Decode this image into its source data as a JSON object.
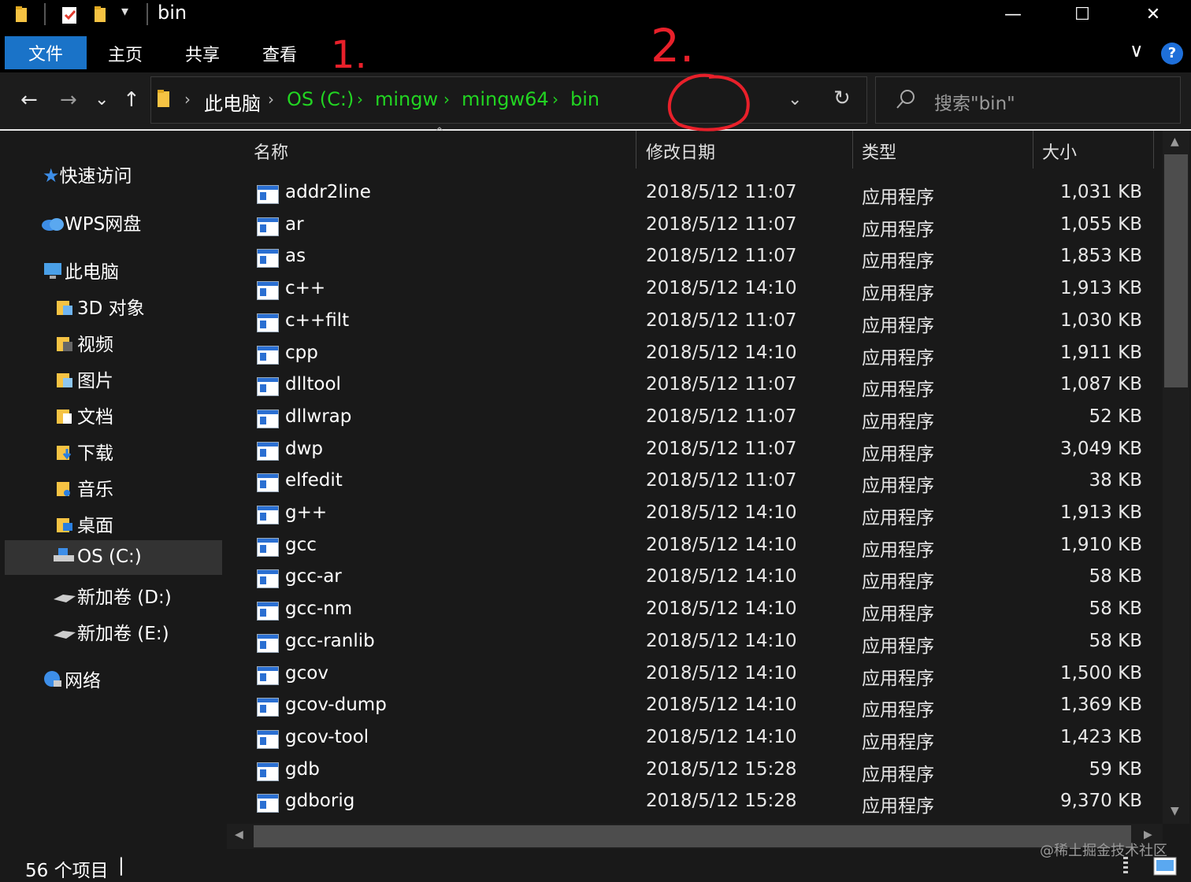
{
  "window": {
    "title": "bin",
    "quick_access_dropdown": "▾",
    "minimize": "—",
    "maximize": "☐",
    "close": "✕"
  },
  "ribbon": {
    "tabs": [
      "文件",
      "主页",
      "共享",
      "查看"
    ],
    "collapse": "∨",
    "help": "?"
  },
  "annotations": {
    "mark1": "1.",
    "mark2": "2.",
    "circle_color": "#e8202a"
  },
  "nav": {
    "back": "←",
    "forward": "→",
    "recent": "⌄",
    "up": "↑",
    "breadcrumbs": [
      "此电脑",
      "OS (C:)",
      "mingw",
      "mingw64",
      "bin"
    ],
    "crumb_sep": "›",
    "history_dropdown": "⌄",
    "refresh": "↻",
    "search_placeholder": "搜索\"bin\""
  },
  "sidebar": {
    "items": [
      {
        "label": "快速访问",
        "icon": "star-icon"
      },
      {
        "label": "WPS网盘",
        "icon": "cloud-icon"
      },
      {
        "label": "此电脑",
        "icon": "computer-icon"
      },
      {
        "label": "3D 对象",
        "icon": "folder-3d-icon"
      },
      {
        "label": "视频",
        "icon": "folder-video-icon"
      },
      {
        "label": "图片",
        "icon": "folder-pictures-icon"
      },
      {
        "label": "文档",
        "icon": "folder-documents-icon"
      },
      {
        "label": "下载",
        "icon": "folder-downloads-icon"
      },
      {
        "label": "音乐",
        "icon": "folder-music-icon"
      },
      {
        "label": "桌面",
        "icon": "folder-desktop-icon"
      },
      {
        "label": "OS (C:)",
        "icon": "drive-c-icon"
      },
      {
        "label": "新加卷 (D:)",
        "icon": "drive-icon"
      },
      {
        "label": "新加卷 (E:)",
        "icon": "drive-icon"
      },
      {
        "label": "网络",
        "icon": "network-icon"
      }
    ]
  },
  "columns": {
    "name": "名称",
    "date": "修改日期",
    "type": "类型",
    "size": "大小"
  },
  "files": [
    {
      "name": "addr2line",
      "date": "2018/5/12 11:07",
      "type": "应用程序",
      "size": "1,031 KB"
    },
    {
      "name": "ar",
      "date": "2018/5/12 11:07",
      "type": "应用程序",
      "size": "1,055 KB"
    },
    {
      "name": "as",
      "date": "2018/5/12 11:07",
      "type": "应用程序",
      "size": "1,853 KB"
    },
    {
      "name": "c++",
      "date": "2018/5/12 14:10",
      "type": "应用程序",
      "size": "1,913 KB"
    },
    {
      "name": "c++filt",
      "date": "2018/5/12 11:07",
      "type": "应用程序",
      "size": "1,030 KB"
    },
    {
      "name": "cpp",
      "date": "2018/5/12 14:10",
      "type": "应用程序",
      "size": "1,911 KB"
    },
    {
      "name": "dlltool",
      "date": "2018/5/12 11:07",
      "type": "应用程序",
      "size": "1,087 KB"
    },
    {
      "name": "dllwrap",
      "date": "2018/5/12 11:07",
      "type": "应用程序",
      "size": "52 KB"
    },
    {
      "name": "dwp",
      "date": "2018/5/12 11:07",
      "type": "应用程序",
      "size": "3,049 KB"
    },
    {
      "name": "elfedit",
      "date": "2018/5/12 11:07",
      "type": "应用程序",
      "size": "38 KB"
    },
    {
      "name": "g++",
      "date": "2018/5/12 14:10",
      "type": "应用程序",
      "size": "1,913 KB"
    },
    {
      "name": "gcc",
      "date": "2018/5/12 14:10",
      "type": "应用程序",
      "size": "1,910 KB"
    },
    {
      "name": "gcc-ar",
      "date": "2018/5/12 14:10",
      "type": "应用程序",
      "size": "58 KB"
    },
    {
      "name": "gcc-nm",
      "date": "2018/5/12 14:10",
      "type": "应用程序",
      "size": "58 KB"
    },
    {
      "name": "gcc-ranlib",
      "date": "2018/5/12 14:10",
      "type": "应用程序",
      "size": "58 KB"
    },
    {
      "name": "gcov",
      "date": "2018/5/12 14:10",
      "type": "应用程序",
      "size": "1,500 KB"
    },
    {
      "name": "gcov-dump",
      "date": "2018/5/12 14:10",
      "type": "应用程序",
      "size": "1,369 KB"
    },
    {
      "name": "gcov-tool",
      "date": "2018/5/12 14:10",
      "type": "应用程序",
      "size": "1,423 KB"
    },
    {
      "name": "gdb",
      "date": "2018/5/12 15:28",
      "type": "应用程序",
      "size": "59 KB"
    },
    {
      "name": "gdborig",
      "date": "2018/5/12 15:28",
      "type": "应用程序",
      "size": "9,370 KB"
    }
  ],
  "status": {
    "count": "56 个项目",
    "separator": "|"
  },
  "watermark": "@稀土掘金技术社区",
  "colors": {
    "accent": "#1a73c8",
    "breadcrumb_highlight": "#22d422",
    "background": "#191919"
  }
}
